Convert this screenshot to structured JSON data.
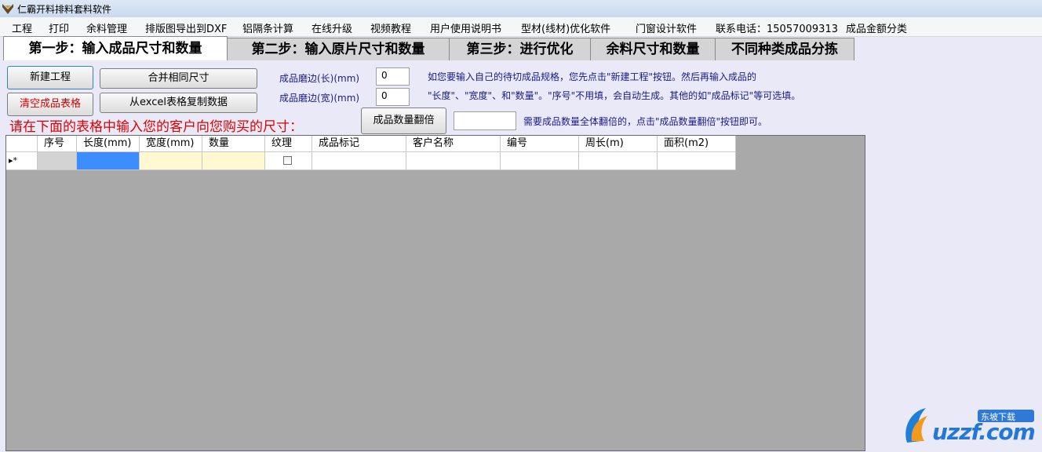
{
  "window": {
    "title": "仁霸开料排料套料软件"
  },
  "menu": [
    "工程",
    "打印",
    "余料管理",
    "排版图导出到DXF",
    "铝隔条计算",
    "在线升级",
    "视频教程",
    "用户使用说明书",
    "型材(线材)优化软件",
    "门窗设计软件",
    "联系电话：15057009313",
    "成品金额分类"
  ],
  "tabs": [
    "第一步：输入成品尺寸和数量",
    "第二步：输入原片尺寸和数量",
    "第三步：进行优化",
    "余料尺寸和数量",
    "不同种类成品分拣"
  ],
  "buttons": {
    "new_project": "新建工程",
    "clear_table": "清空成品表格",
    "merge_same": "合并相同尺寸",
    "copy_excel": "从excel表格复制数据",
    "double_qty": "成品数量翻倍"
  },
  "fields": {
    "edge_long_label": "成品磨边(长)(mm)",
    "edge_long_value": "0",
    "edge_wide_label": "成品磨边(宽)(mm)",
    "edge_wide_value": "0",
    "double_value": ""
  },
  "hints": {
    "line1": "如您要输入自己的待切成品规格，您先点击\"新建工程\"按钮。然后再输入成品的",
    "line2": "\"长度\"、\"宽度\"、和\"数量\"。\"序号\"不用填，会自动生成。其他的如\"成品标记\"等可选填。",
    "double": "需要成品数量全体翻倍的，点击\"成品数量翻倍\"按钮即可。"
  },
  "instruction": "请在下面的表格中输入您的客户向您购买的尺寸：",
  "table": {
    "columns": [
      "序号",
      "长度(mm)",
      "宽度(mm)",
      "数量",
      "纹理",
      "成品标记",
      "客户名称",
      "编号",
      "周长(m)",
      "面积(m2)"
    ],
    "new_row_marker": "▸*",
    "texture_checked": false
  },
  "watermark": {
    "text": "uzzf.com",
    "badge": "东坡下载"
  },
  "colors": {
    "selected_cell": "#3c8dff",
    "input_cell": "#fff8d0",
    "readonly_cell": "#d3d3d3",
    "grid_bg": "#a9a9a9",
    "red_text": "#e00000"
  }
}
